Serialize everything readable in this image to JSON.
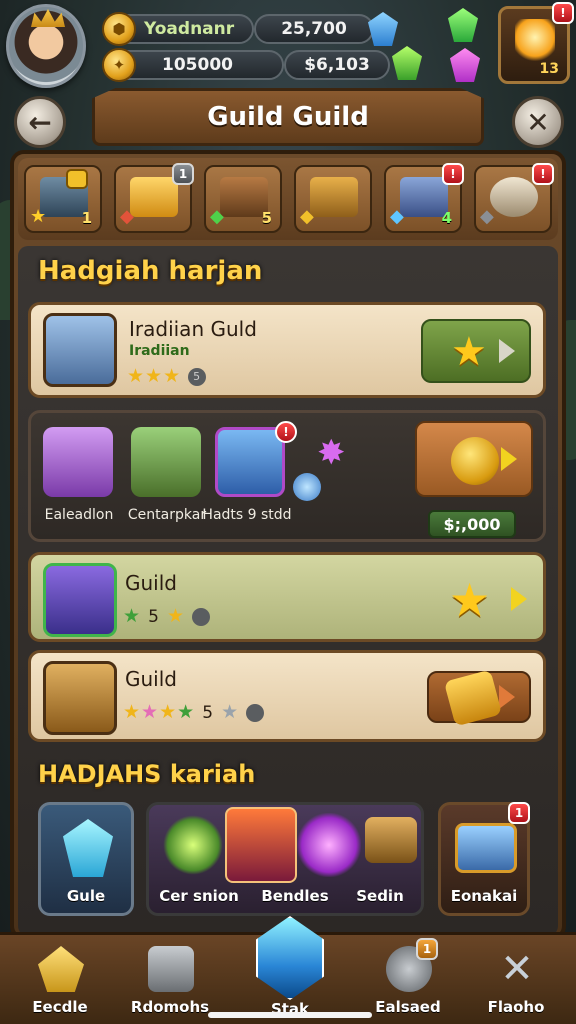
{
  "hud": {
    "player_name": "Yoadnanr",
    "gold_primary": "25,700",
    "gold_secondary": "105000",
    "currency_right": "$6,103",
    "corner_count": "13",
    "corner_badge": "!"
  },
  "header": {
    "title": "Guild Guild",
    "back_icon": "back-arrow-icon",
    "close_icon": "close-icon"
  },
  "tabs": [
    {
      "badge": "",
      "count": "1",
      "badge_type": "gold"
    },
    {
      "badge": "1",
      "count": "",
      "badge_type": "gray"
    },
    {
      "badge": "",
      "count": "5",
      "badge_type": ""
    },
    {
      "badge": "",
      "count": "",
      "badge_type": ""
    },
    {
      "badge": "!",
      "count": "4",
      "badge_type": "red"
    },
    {
      "badge": "!",
      "count": "",
      "badge_type": "red"
    }
  ],
  "daily": {
    "title": "Hadgiah harjan",
    "card1": {
      "title": "Iradiian Guld",
      "sub": "Iradiian",
      "extra": "5"
    },
    "bundle": {
      "items": [
        {
          "label": "Ealeadlon"
        },
        {
          "label": "Centarpkar"
        },
        {
          "label": "Hadts 9 stdd"
        }
      ],
      "badge": "!",
      "price": "$;,000"
    },
    "card3": {
      "title": "Guild",
      "count": "5"
    },
    "card4": {
      "title": "Guild",
      "count": "5"
    }
  },
  "shop": {
    "title": "HADJAHS kariah",
    "cards": [
      {
        "label": "Gule"
      },
      {
        "label": "Cer snion"
      },
      {
        "label": "Bendles"
      },
      {
        "label": "Sedin"
      },
      {
        "label": "Eonakai",
        "badge": "1"
      }
    ]
  },
  "nav": {
    "items": [
      {
        "label": "Eecdle"
      },
      {
        "label": "Rdomohs"
      },
      {
        "label": "Stak"
      },
      {
        "label": "Ealsaed",
        "badge": "1"
      },
      {
        "label": "Flaoho"
      }
    ]
  }
}
